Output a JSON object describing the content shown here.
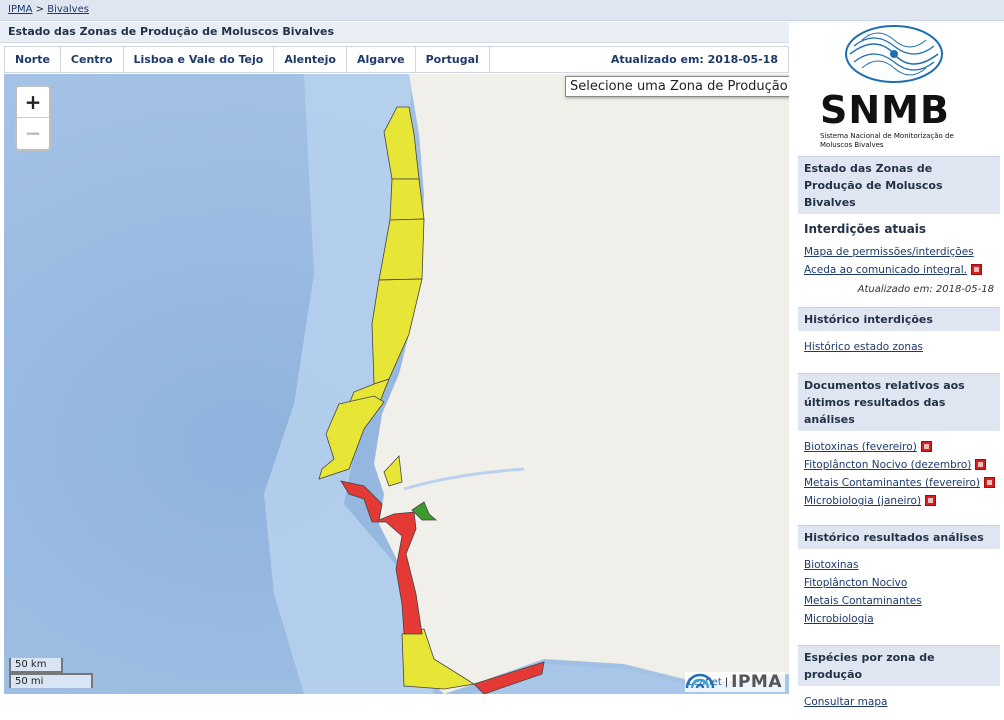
{
  "breadcrumb": {
    "home": "IPMA",
    "sep": ">",
    "current": "Bivalves"
  },
  "page_title": "Estado das Zonas de Produção de Moluscos Bivalves",
  "regions": [
    "Norte",
    "Centro",
    "Lisboa e Vale do Tejo",
    "Alentejo",
    "Algarve",
    "Portugal"
  ],
  "updated_label": "Atualizado em: 2018-05-18",
  "map": {
    "zoom_in": "+",
    "zoom_out": "−",
    "select_prompt": "Selecione uma Zona de Produção",
    "scale_km": "50 km",
    "scale_mi": "50 mi",
    "attribution_link": "Leaflet",
    "attribution_sep": "|",
    "attribution_brand": "IPMA",
    "colors": {
      "sea": "#a8c6e8",
      "land": "#f1efe9",
      "open": "#e7e535",
      "closed": "#e53935",
      "temporary": "#3c9a2e"
    }
  },
  "sidebar": {
    "logo_title": "SNMB",
    "logo_subtitle": "Sistema Nacional de Monitorização de Moluscos Bivalves",
    "panel_estado": {
      "title": "Estado das Zonas de Produção de Moluscos Bivalves",
      "subtitle": "Interdições atuais",
      "links": [
        "Mapa de permissões/interdições",
        "Aceda ao comunicado integral."
      ],
      "updated": "Atualizado em: 2018-05-18"
    },
    "panel_historico": {
      "title": "Histórico interdições",
      "links": [
        "Histórico estado zonas"
      ]
    },
    "panel_documentos": {
      "title": "Documentos relativos aos últimos resultados das análises",
      "links": [
        "Biotoxinas (fevereiro)",
        "Fitoplâncton Nocivo (dezembro)",
        "Metais Contaminantes (fevereiro)",
        "Microbiologia (janeiro)"
      ]
    },
    "panel_resultados": {
      "title": "Histórico resultados análises",
      "links": [
        "Biotoxinas",
        "Fitoplâncton Nocivo",
        "Metais Contaminantes",
        "Microbiologia"
      ]
    },
    "panel_especies": {
      "title": "Espécies por zona de produção",
      "links": [
        "Consultar mapa"
      ]
    }
  }
}
